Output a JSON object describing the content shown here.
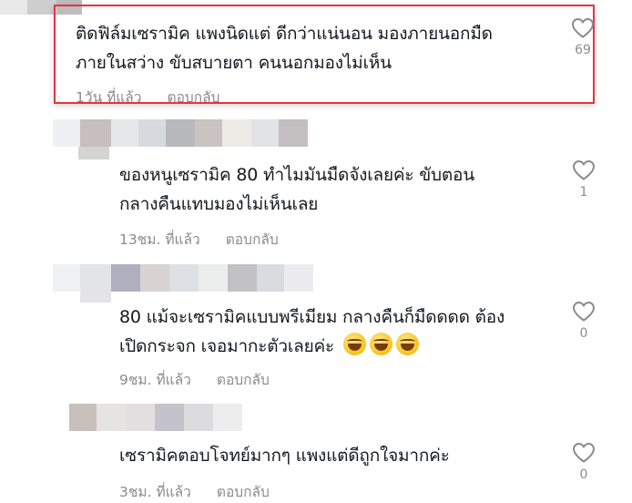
{
  "comments": [
    {
      "text_lines": [
        "ติดฟิล์มเซรามิค แพงนิดแต่ ดีกว่าแน่นอน มองภายนอกมืด",
        "ภายในสว่าง ขับสบายตา คนนอกมองไม่เห็น"
      ],
      "time": "1วัน ที่แล้ว",
      "reply_label": "ตอบกลับ",
      "likes": "69",
      "highlighted": true
    },
    {
      "text_lines": [
        "ของหนูเซรามิค 80 ทำไมมันมืดจังเลยค่ะ ขับตอน",
        "กลางคืนแทบมองไม่เห็นเลย"
      ],
      "time": "13ชม. ที่แล้ว",
      "reply_label": "ตอบกลับ",
      "likes": "1"
    },
    {
      "text_lines": [
        "80 แม้จะเซรามิคแบบพรีเมียม กลางคืนก็มืดดดด ต้อง",
        "เปิดกระจก เจอมากะตัวเลยค่ะ"
      ],
      "emoji": [
        "face-with-tears-of-joy",
        "face-with-tears-of-joy",
        "face-with-tears-of-joy"
      ],
      "time": "9ชม. ที่แล้ว",
      "reply_label": "ตอบกลับ",
      "likes": "0"
    },
    {
      "text_lines": [
        "เซรามิคตอบโจทย์มากๆ แพงแต่ดีถูกใจมากค่ะ"
      ],
      "time": "3ชม. ที่แล้ว",
      "reply_label": "ตอบกลับ",
      "likes": "0"
    }
  ],
  "colors": {
    "text": "#161823",
    "meta": "#8a8b91",
    "highlight_border": "#e4353f"
  },
  "icons": {
    "like": "heart-outline-icon"
  }
}
